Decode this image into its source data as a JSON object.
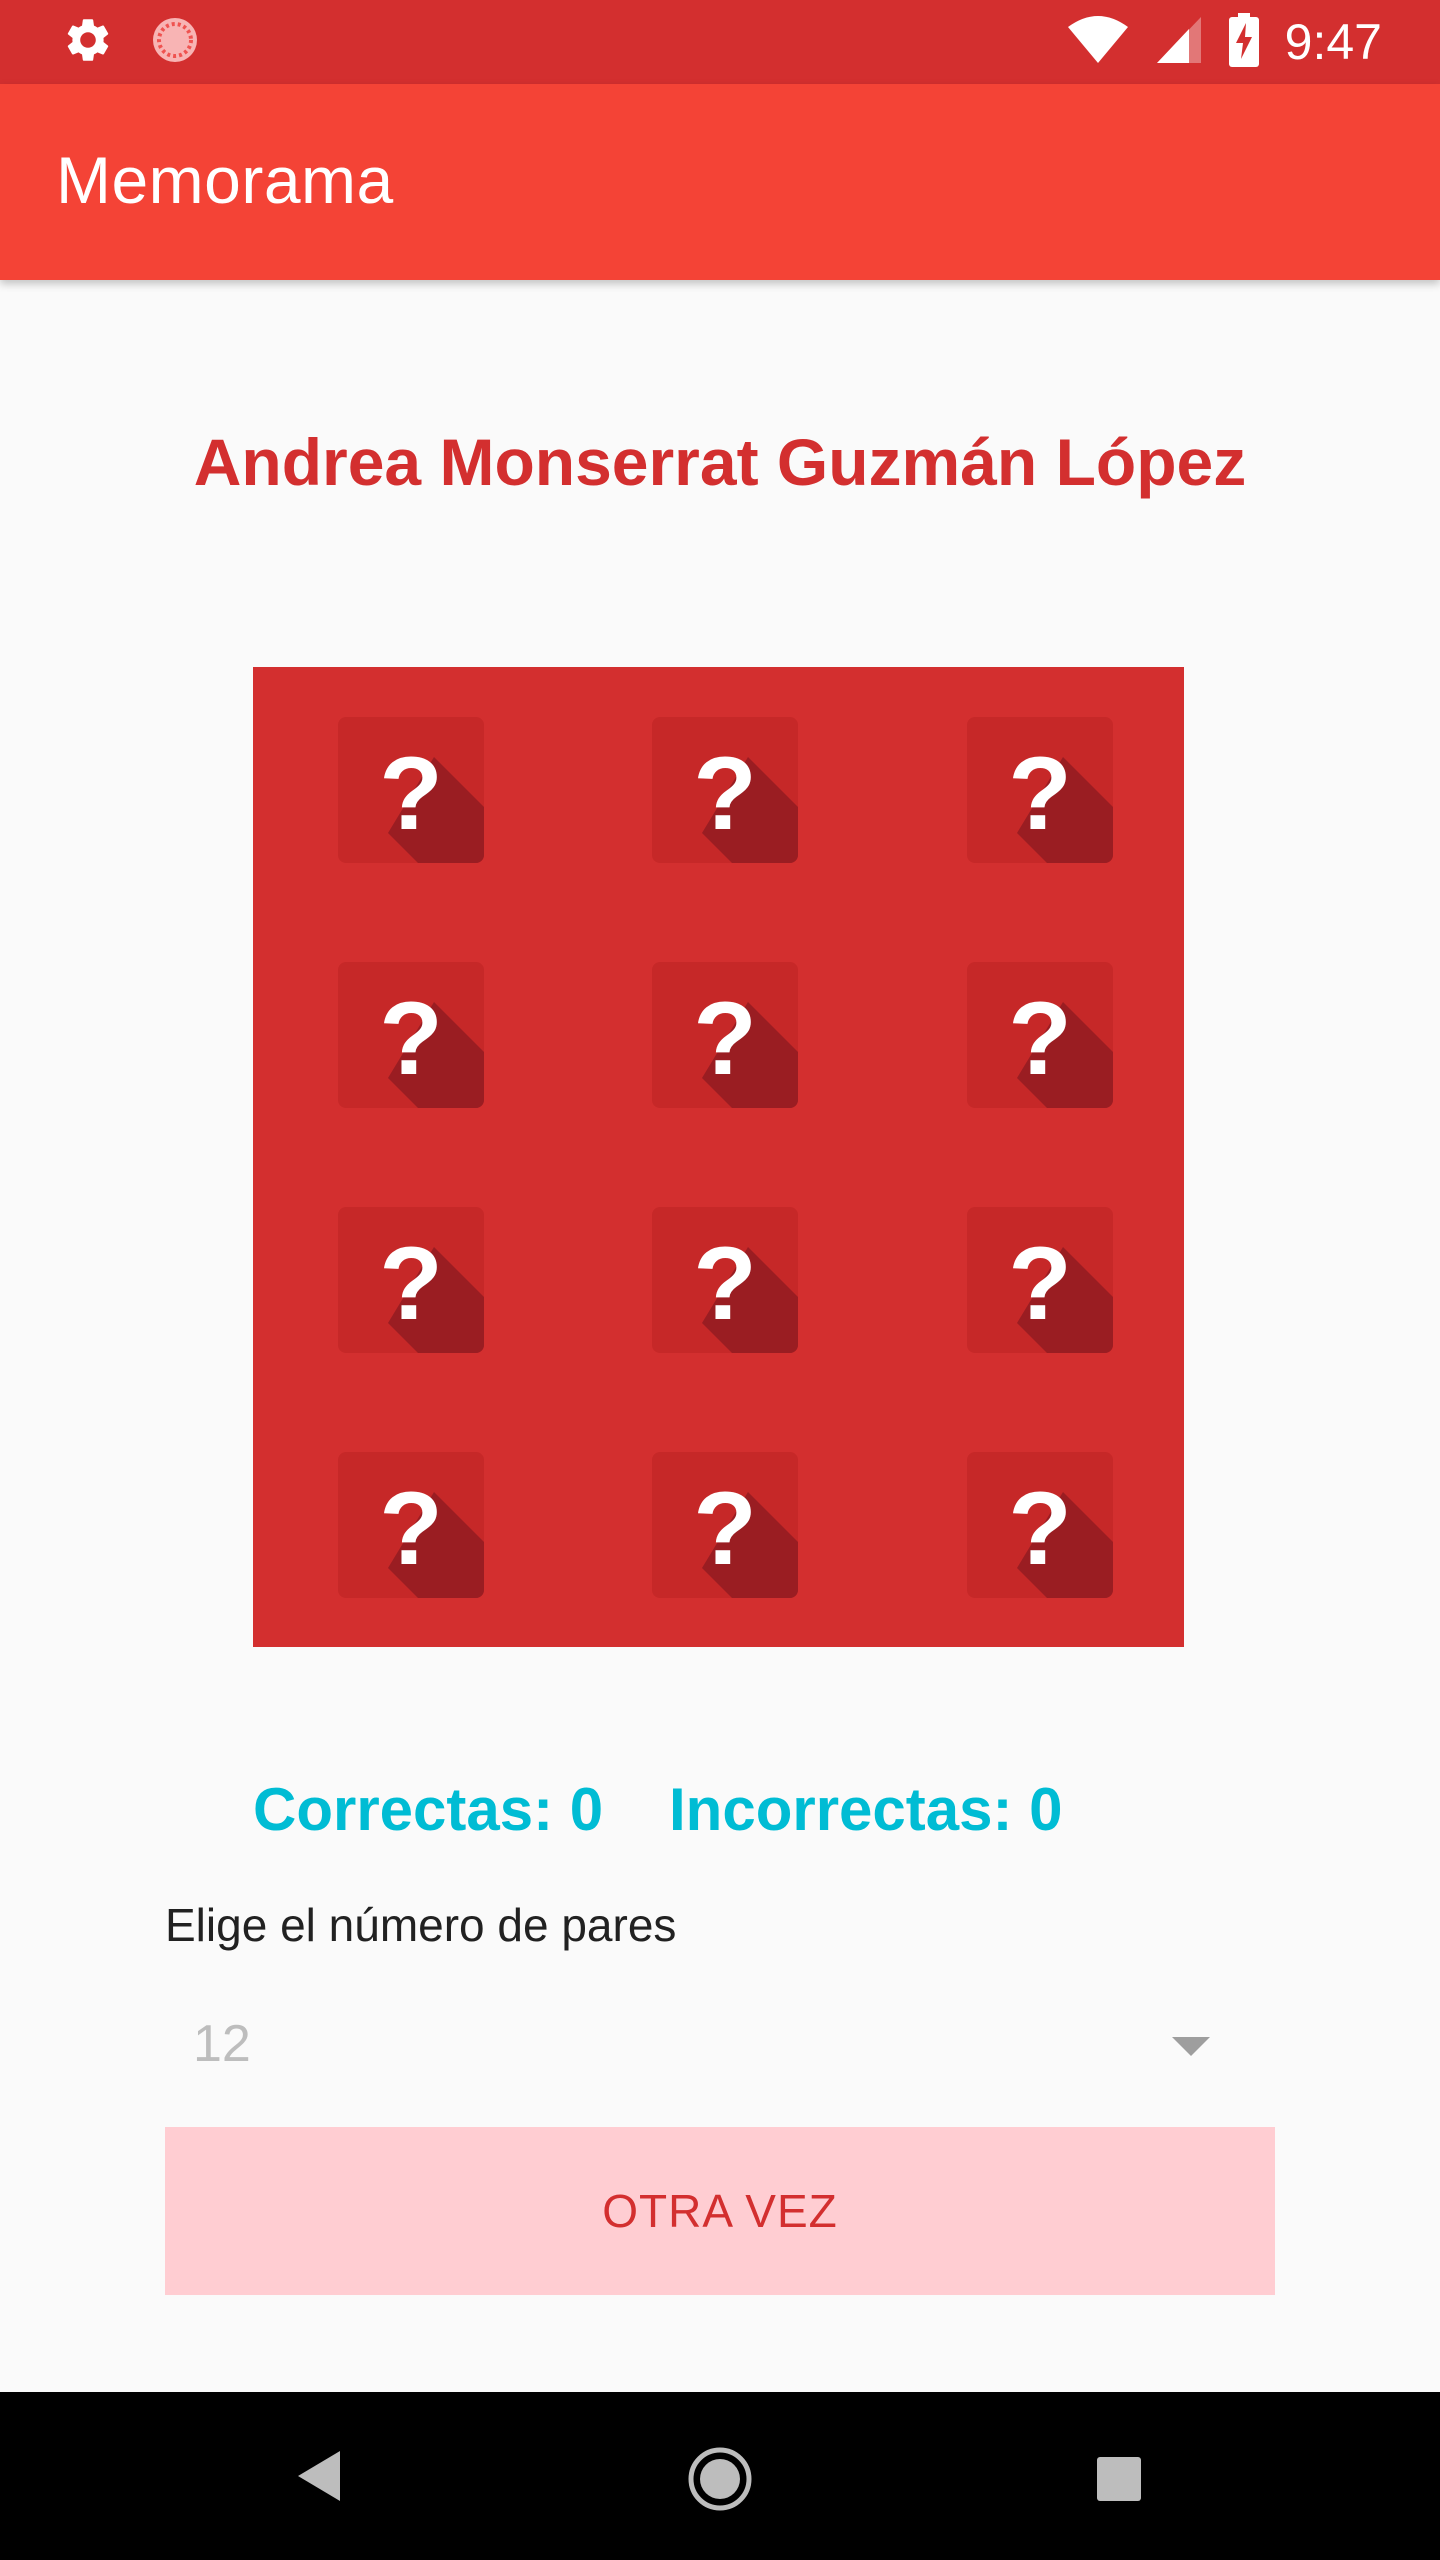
{
  "status_bar": {
    "time": "9:47",
    "left_icons": [
      "settings-icon",
      "loading-indicator-icon"
    ],
    "right_icons": [
      "wifi-icon",
      "cell-signal-icon",
      "battery-charging-icon"
    ]
  },
  "app_bar": {
    "title": "Memorama"
  },
  "player": {
    "name": "Andrea Monserrat Guzmán López"
  },
  "board": {
    "rows": 4,
    "columns": 3,
    "card_symbol": "?",
    "card_state": "face-down",
    "colors": {
      "board": "#d32f2f",
      "card": "#c62828",
      "card_shadow": "#9a1d22"
    }
  },
  "score": {
    "correct": "Correctas: 0",
    "incorrect": "Incorrectas: 0"
  },
  "pairs": {
    "label": "Elige el número de pares",
    "selected": "12"
  },
  "actions": {
    "again_label": "OTRA VEZ"
  },
  "nav_bar": {
    "icons": [
      "back-icon",
      "home-icon",
      "recents-icon"
    ]
  },
  "colors": {
    "status_bar": "#d32f2f",
    "app_bar": "#f44336",
    "accent": "#d32f2f",
    "score": "#00bcd4",
    "button_bg": "#ffcdd2"
  }
}
